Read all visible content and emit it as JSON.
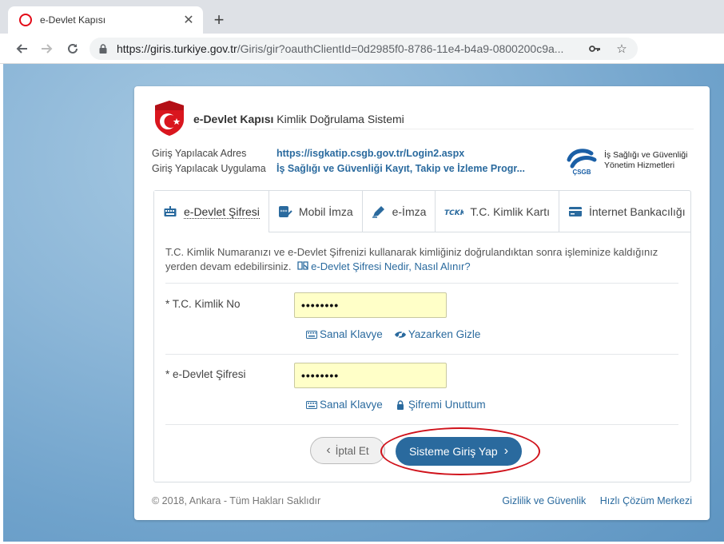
{
  "browser": {
    "tab_title": "e-Devlet Kapısı",
    "tab_close": "✕",
    "new_tab": "+",
    "url_host": "https://giris.turkiye.gov.tr",
    "url_rest": "/Giris/gir?oauthClientId=0d2985f0-8786-11e4-b4a9-0800200c9a..."
  },
  "header": {
    "brand_bold": "e-Devlet Kapısı",
    "brand_rest": " Kimlik Doğrulama Sistemi"
  },
  "info": {
    "address_label": "Giriş Yapılacak Adres",
    "address_value": "https://isgkatip.csgb.gov.tr/Login2.aspx",
    "app_label": "Giriş Yapılacak Uygulama",
    "app_value": "İş Sağlığı ve Güvenliği Kayıt, Takip ve İzleme Progr..."
  },
  "partner": {
    "abbr": "ÇSGB",
    "line1": "İş Sağlığı ve Güvenliği",
    "line2": "Yönetim Hizmetleri"
  },
  "tabs": [
    {
      "label": "e-Devlet Şifresi"
    },
    {
      "label": "Mobil İmza"
    },
    {
      "label": "e-İmza"
    },
    {
      "label": "T.C. Kimlik Kartı"
    },
    {
      "label": "İnternet Bankacılığı"
    }
  ],
  "tckk_badge": "TCKK",
  "form": {
    "description": "T.C. Kimlik Numaranızı ve e-Devlet Şifrenizi kullanarak kimliğiniz doğrulandıktan sonra işleminize kaldığınız yerden devam edebilirsiniz.",
    "help_link": "e-Devlet Şifresi Nedir, Nasıl Alınır?",
    "tc_label": "* T.C. Kimlik No",
    "tc_value": "••••••••",
    "virtual_keyboard": "Sanal Klavye",
    "hide_typing": "Yazarken Gizle",
    "password_label": "* e-Devlet Şifresi",
    "password_value": "••••••••",
    "forgot_password": "Şifremi Unuttum",
    "cancel": "İptal Et",
    "submit": "Sisteme Giriş Yap"
  },
  "footer": {
    "copyright": "© 2018, Ankara - Tüm Hakları Saklıdır",
    "privacy": "Gizlilik ve Güvenlik",
    "support": "Hızlı Çözüm Merkezi"
  },
  "colors": {
    "accent": "#2a6a9e",
    "input_bg": "#ffffc8",
    "highlight_ellipse": "#d0121b"
  }
}
